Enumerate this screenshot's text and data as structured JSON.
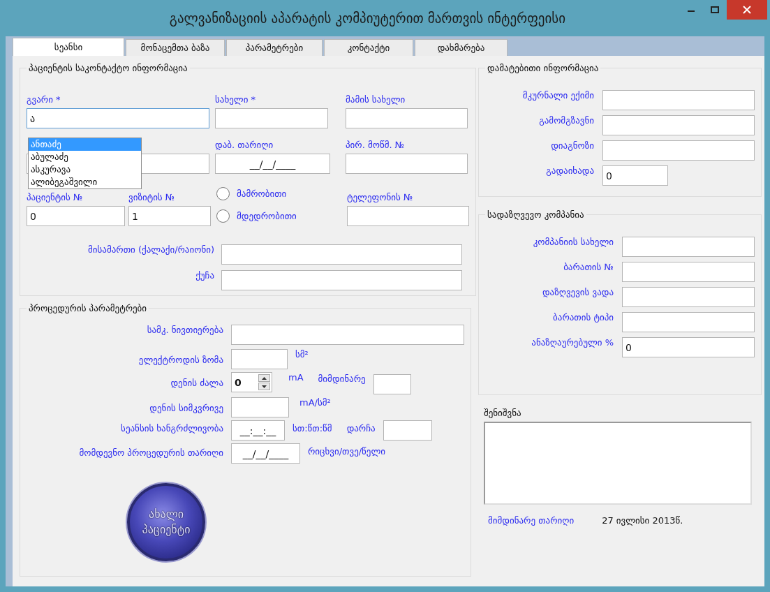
{
  "window": {
    "title": "გალვანიზაციის აპარატის კომპიუტერით მართვის ინტერფეისი"
  },
  "tabs": [
    {
      "label": "სეანსი",
      "selected": true
    },
    {
      "label": "მონაცემთა ბაზა",
      "selected": false
    },
    {
      "label": "პარამეტრები",
      "selected": false
    },
    {
      "label": "კონტაქტი",
      "selected": false
    },
    {
      "label": "დახმარება",
      "selected": false
    }
  ],
  "patient_contact": {
    "title": "პაციენტის საკონტაქტო ინფორმაცია",
    "surname": {
      "label": "გვარი *",
      "value": "ა",
      "focused": true
    },
    "name": {
      "label": "სახელი *"
    },
    "fathers_name": {
      "label": "მამის სახელი"
    },
    "birth_date": {
      "label": "დაბ. თარიღი",
      "value": "__/__/____"
    },
    "id_number": {
      "label": "პირ. მოწმ. №"
    },
    "patient_number": {
      "label": "პაციენტის №",
      "value": "0"
    },
    "visit_number": {
      "label": "ვიზიტის  №",
      "value": "1"
    },
    "gender": [
      {
        "label": "მამრობითი",
        "selected": false
      },
      {
        "label": "მდედრობითი",
        "selected": false
      }
    ],
    "phone": {
      "label": "ტელეფონის №"
    },
    "address": {
      "label": "მისამართი (ქალაქი/რაიონი)"
    },
    "street": {
      "label": "ქუჩა"
    }
  },
  "suggestions": [
    {
      "text": "ანთაძე",
      "selected": true
    },
    {
      "text": "აბულაძე",
      "selected": false
    },
    {
      "text": "ასკურავა",
      "selected": false
    },
    {
      "text": "ალიბეგაშვილი",
      "selected": false
    }
  ],
  "procedure": {
    "title": "პროცედურის პარამეტრები",
    "substance": {
      "label": "სამკ. ნივთიერება"
    },
    "electrode_size": {
      "label": "ელექტროდის ზომა",
      "unit": "სმ²"
    },
    "current": {
      "label": "დენის ძალა",
      "value": "0",
      "unit": "mA",
      "live_label": "მიმდინარე"
    },
    "density": {
      "label": "დენის სიმკვრივე",
      "unit": "mA/სმ²"
    },
    "duration": {
      "label": "სეანსის ხანგრძლივობა",
      "value": "__:__:__",
      "unit": "სთ:წთ:წმ",
      "remaining_label": "დარჩა"
    },
    "next_date": {
      "label": "მომდევნო პროცედურის თარიღი",
      "value": "__/__/____",
      "unit": "რიცხვი/თვე/წელი"
    }
  },
  "new_patient_button": {
    "lines": [
      "ახალი",
      "პაციენტი"
    ]
  },
  "additional_info": {
    "title": "დამატებითი ინფორმაცია",
    "fields": [
      {
        "label": "მკურნალი ექიმი",
        "kind": "wide"
      },
      {
        "label": "გამომგზავნი",
        "kind": "wide"
      },
      {
        "label": "დიაგნოზი",
        "kind": "wide"
      },
      {
        "label": "გადაიხადა",
        "value": "0",
        "kind": "short"
      }
    ]
  },
  "insurance": {
    "title": "სადაზღვევო კომპანია",
    "fields": [
      {
        "label": "კომპანიის სახელი",
        "kind": "wide"
      },
      {
        "label": "ბარათის №",
        "kind": "wide"
      },
      {
        "label": "დაზღვევის ვადა",
        "kind": "wide"
      },
      {
        "label": "ბარათის ტიპი",
        "kind": "wide"
      },
      {
        "label": "ანაზღაურებული %",
        "value": "0",
        "kind": "wide"
      }
    ]
  },
  "note": {
    "label": "შენიშვნა"
  },
  "current_date": {
    "label": "მიმდინარე თარიღი",
    "value": "27 ივლისი 2013წ."
  }
}
